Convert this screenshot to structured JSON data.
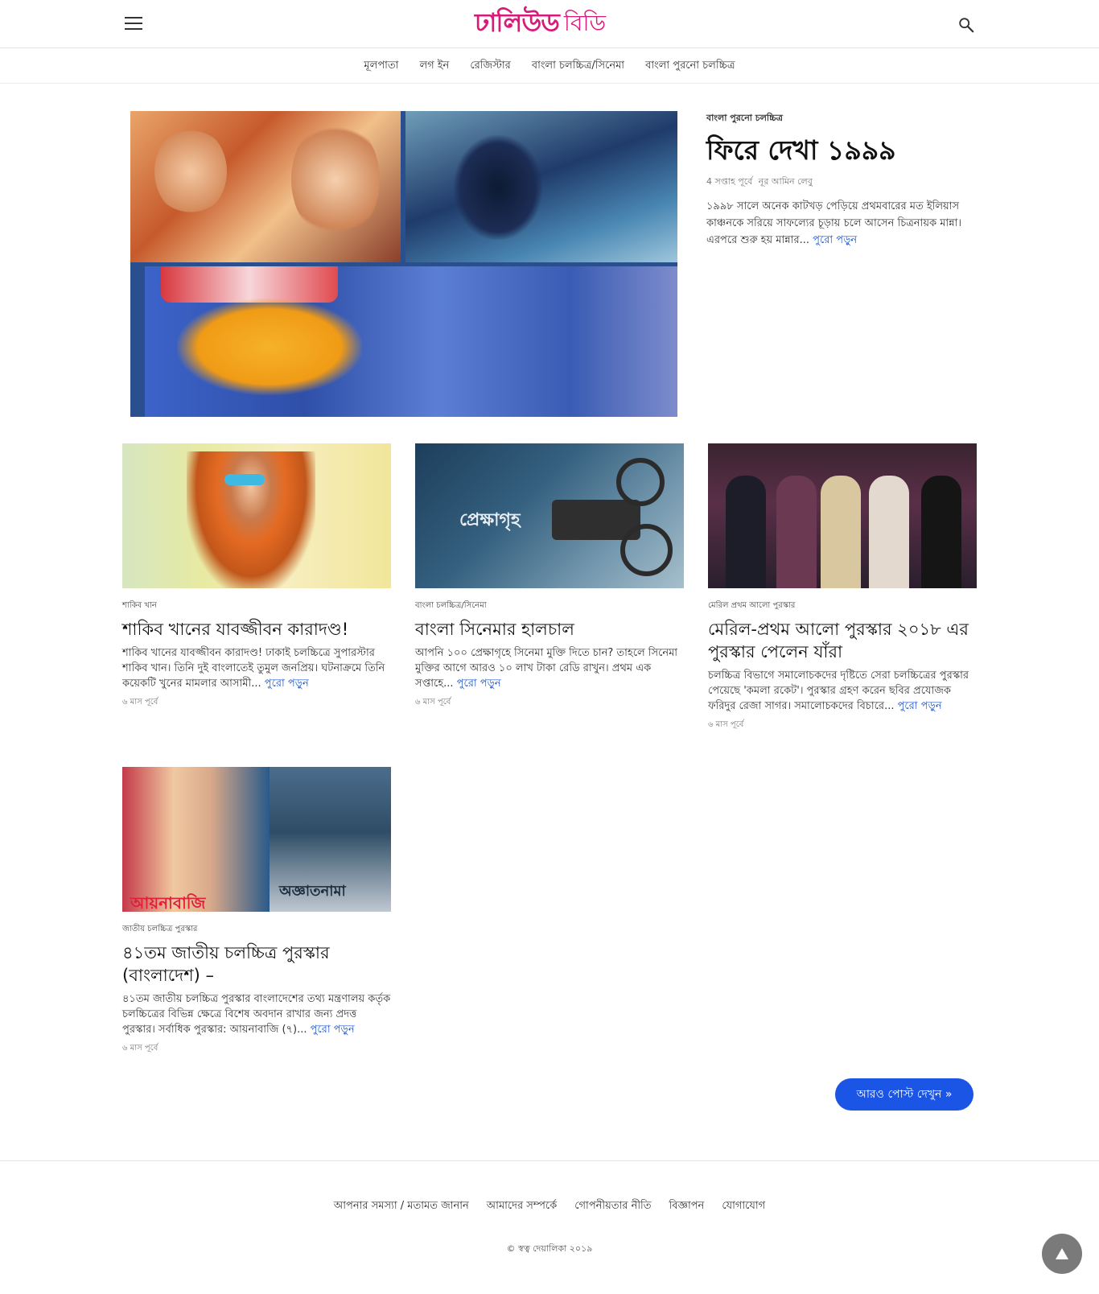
{
  "header": {
    "logo_main": "ঢালিউড",
    "logo_sub": "বিডি"
  },
  "nav": {
    "items": [
      "মূলপাতা",
      "লগ ইন",
      "রেজিস্টার",
      "বাংলা চলচ্চিত্র/সিনেমা",
      "বাংলা পুরনো চলচ্চিত্র"
    ]
  },
  "featured": {
    "category": "বাংলা পুরনো চলচ্চিত্র",
    "title": "ফিরে দেখা ১৯৯৯",
    "time": "4 সপ্তাহ পূর্বে",
    "author": "নূর আমিন লেবু",
    "excerpt": "১৯৯৮ সালে অনেক কাটখড় পেড়িয়ে প্রথমবারের মত ইলিয়াস কাঞ্চনকে সরিয়ে সাফল্যের চূড়ায় চলে আসেন চিত্রনায়ক মান্না। এরপরে শুরু হয় মান্নার...",
    "read_more": "পুরো পড়ুন"
  },
  "cards": [
    {
      "category": "শাকিব খান",
      "title": "শাকিব খানের যাবজ্জীবন কারাদণ্ড!",
      "excerpt": "শাকিব খানের যাবজ্জীবন কারাদণ্ড! ঢাকাই চলচ্চিত্রে সুপারস্টার শাকিব খান। তিনি দুই বাংলাতেই তুমুল জনপ্রিয়। ঘটনাক্রমে তিনি কয়েকটি খুনের মামলার আসামী...",
      "read_more": "পুরো পড়ুন",
      "time": "৬ মাস পূর্বে"
    },
    {
      "category": "বাংলা চলচ্চিত্র/সিনেমা",
      "title": "বাংলা সিনেমার হালচাল",
      "excerpt": "আপনি ১০০ প্রেক্ষাগৃহে সিনেমা মুক্তি দিতে চান? তাহলে সিনেমা মুক্তির আগে আরও ১০ লাখ টাকা রেডি রাখুন। প্রথম এক সপ্তাহে...",
      "read_more": "পুরো পড়ুন",
      "time": "৬ মাস পূর্বে"
    },
    {
      "category": "মেরিল প্রথম আলো পুরস্কার",
      "title": "মেরিল-প্রথম আলো পুরস্কার ২০১৮ এর পুরস্কার পেলেন যাঁরা",
      "excerpt": "চলচ্চিত্র বিভাগে সমালোচকদের দৃষ্টিতে সেরা চলচ্চিত্রের পুরস্কার পেয়েছে 'কমলা রকেট'। পুরস্কার গ্রহণ করেন ছবির প্রযোজক ফরিদুর রেজা সাগর। সমালোচকদের বিচারে...",
      "read_more": "পুরো পড়ুন",
      "time": "৬ মাস পূর্বে"
    },
    {
      "category": "জাতীয় চলচ্চিত্র পুরস্কার",
      "title": "৪১তম জাতীয় চলচ্চিত্র পুরস্কার (বাংলাদেশ) –",
      "excerpt": "৪১তম জাতীয় চলচ্চিত্র পুরস্কার বাংলাদেশের তথ্য মন্ত্রণালয় কর্তৃক চলচ্চিত্রের বিভিন্ন ক্ষেত্রে বিশেষ অবদান রাখার জন্য প্রদত্ত পুরস্কার। সর্বাধিক পুরস্কার: আয়নাবাজি (৭)...",
      "read_more": "পুরো পড়ুন",
      "time": "৬ মাস পূর্বে"
    }
  ],
  "card_images": {
    "img2_word": "প্রেক্ষাগৃহ",
    "img4_left_title": "আয়নাবাজি",
    "img4_right_title": "অজ্ঞাতনামা"
  },
  "more_button": "আরও পোস্ট দেখুন »",
  "footer": {
    "links": [
      "আপনার সমস্যা / মতামত জানান",
      "আমাদের সম্পর্কে",
      "গোপনীয়তার নীতি",
      "বিজ্ঞাপন",
      "যোগাযোগ"
    ],
    "copyright": "© স্বত্ব দেয়ালিকা ২০১৯"
  },
  "colors": {
    "brand": "#d81b7a",
    "link": "#1a55c9",
    "button": "#1a55e6"
  }
}
